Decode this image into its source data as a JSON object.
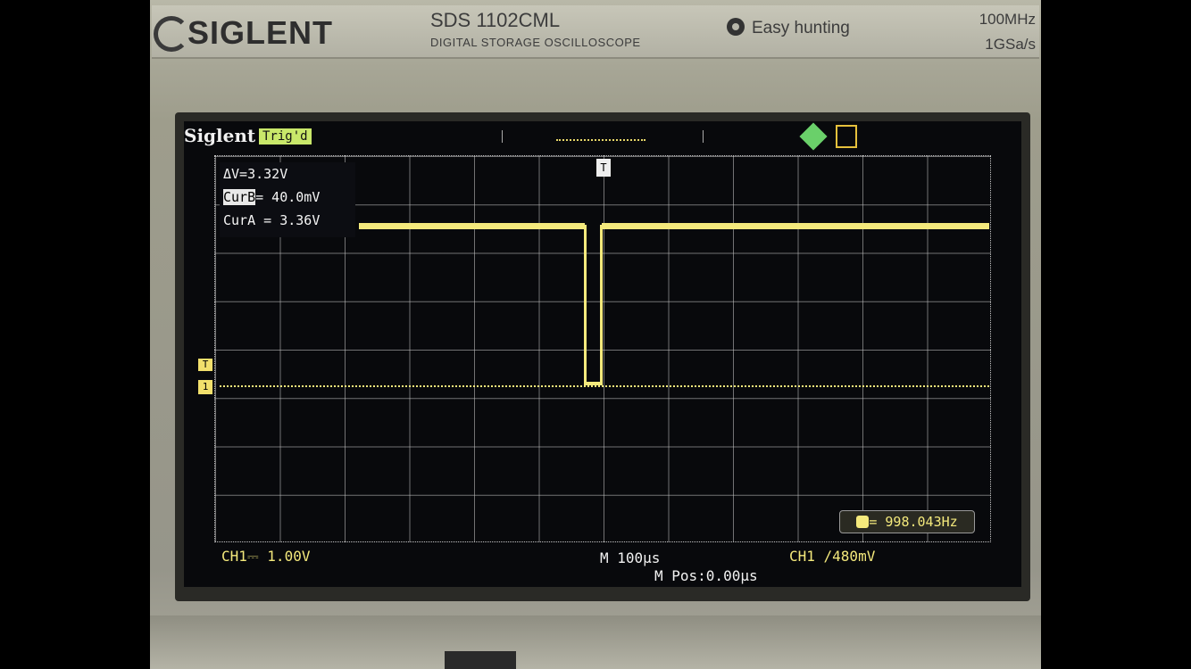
{
  "device": {
    "brand": "SIGLENT",
    "model": "SDS 1102CML",
    "subtitle": "DIGITAL STORAGE OSCILLOSCOPE",
    "feature": "Easy hunting",
    "bandwidth": "100MHz",
    "sample_rate": "1GSa/s"
  },
  "screen": {
    "brand": "Siglent",
    "trigger_status": "Trig'd",
    "cursors": {
      "delta": "ΔV=3.32V",
      "cur_b_tag": "CurB",
      "cur_b_value": "= 40.0mV",
      "cur_a": "CurA = 3.36V"
    },
    "trigger_marker": "T",
    "channel_marker": "1",
    "frequency": "= 998.043Hz",
    "ch1_scale": "CH1⎓ 1.00V",
    "timebase": "M 100μs",
    "trigger_info": "CH1 ∕480mV",
    "horizontal_pos": "M Pos:0.00μs",
    "trace_color": "#f4e97c"
  }
}
